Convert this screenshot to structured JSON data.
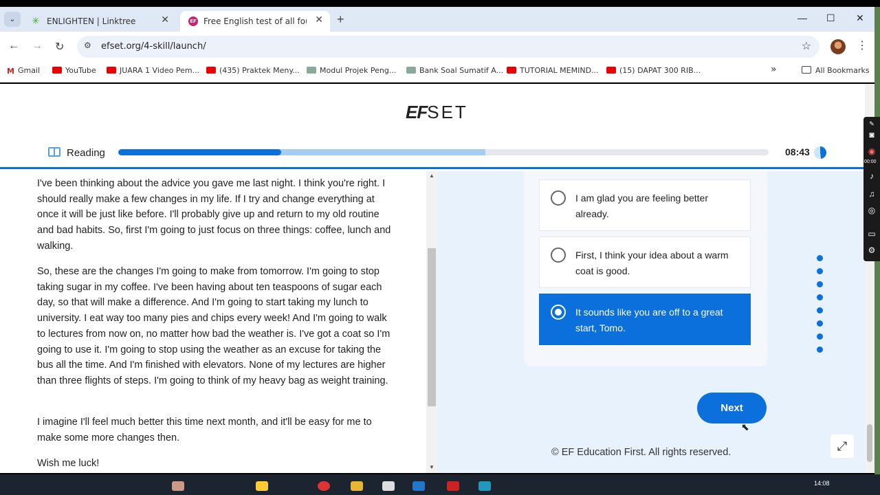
{
  "browser": {
    "tabs": [
      {
        "label": "ENLIGHTEN | Linktree",
        "close": "✕"
      },
      {
        "label": "Free English test of all four skills",
        "close": "✕"
      }
    ],
    "new_tab": "+",
    "window_controls": {
      "minimize": "—",
      "maximize": "☐",
      "close": "✕"
    },
    "url": "efset.org/4-skill/launch/",
    "bookmarks": [
      {
        "label": "Gmail"
      },
      {
        "label": "YouTube"
      },
      {
        "label": "JUARA 1 Video Pem..."
      },
      {
        "label": "(435) Praktek Meny..."
      },
      {
        "label": "Modul Projek Peng..."
      },
      {
        "label": "Bank Soal Sumatif A..."
      },
      {
        "label": "TUTORIAL MEMIND..."
      },
      {
        "label": "(15) DAPAT 300 RIB..."
      }
    ],
    "more_bookmarks": "»",
    "all_bookmarks": "All Bookmarks"
  },
  "header": {
    "logo_ef": "EF",
    "logo_set": "SET",
    "section": "Reading",
    "timer": "08:43"
  },
  "progress": {
    "fill_fraction": 0.25,
    "buffer_fraction": 0.565
  },
  "reading": {
    "paragraphs": [
      "I've been thinking about the advice you gave me last night. I think you're right. I should really make a few changes in my life. If I try and change everything at once it will be just like before. I'll probably give up and return to my old routine and bad habits. So, first I'm going to just focus on three things: coffee, lunch and walking.",
      "So, these are the changes I'm going to make from tomorrow. I'm going to stop taking sugar in my coffee. I've been having about ten teaspoons of sugar each day, so that will make a difference. And I'm going to start taking my lunch to university. I eat way too many pies and chips every week! And I'm going to walk to lectures from now on, no matter how bad the weather is. I've got a coat so I'm going to use it. I'm going to stop using the weather as an excuse for taking the bus all the time. And I'm finished with elevators. None of my lectures are higher than three flights of steps. I'm going to think of my heavy bag as weight training.",
      "I imagine I'll feel much better this time next month, and it'll be easy for me to make some more changes then.",
      "Wish me luck!"
    ]
  },
  "question": {
    "options": [
      {
        "text": "I am glad you are feeling better already.",
        "selected": false
      },
      {
        "text": "First, I think your idea about a warm coat is good.",
        "selected": false
      },
      {
        "text": "It sounds like you are off to a great start, Tomo.",
        "selected": true
      }
    ],
    "next_label": "Next"
  },
  "footer": {
    "copyright": "© EF Education First. All rights reserved."
  },
  "recorder": {
    "time": "00:00"
  },
  "taskbar": {
    "clock": "14:08"
  },
  "colors": {
    "accent": "#0b6fdc",
    "panel": "#e8f2fd"
  }
}
